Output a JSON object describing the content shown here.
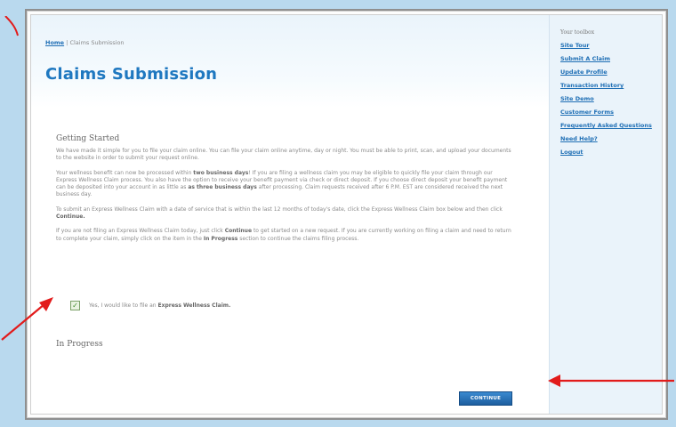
{
  "breadcrumb": {
    "home": "Home",
    "separator": "|",
    "current": "Claims Submission"
  },
  "page_title": "Claims Submission",
  "getting_started": {
    "heading": "Getting Started",
    "p1": "We have made it simple for you to file your claim online. You can file your claim online anytime, day or night. You must be able to print, scan, and upload your documents to the website in order to submit your request online.",
    "p2_a": "Your wellness benefit can now be processed within ",
    "p2_b": "two business days",
    "p2_c": "! If you are filing a wellness claim you may be eligible to quickly file your claim through our Express Wellness Claim process. You also have the option to receive your benefit payment via check or direct deposit. If you choose direct deposit your benefit payment can be deposited into your account in as little as ",
    "p2_d": "as three business days",
    "p2_e": " after processing. Claim requests received after 6 P.M. EST are considered received the next business day.",
    "p3_a": "To submit an Express Wellness Claim with a date of service that is within the last 12 months of today's date, click the Express Wellness Claim box below and then click ",
    "p3_b": "Continue.",
    "p4_a": "If you are not filing an Express Wellness Claim today, just click ",
    "p4_b": "Continue",
    "p4_c": " to get started on a new request. If you are currently working on filing a claim and need to return to complete your claim, simply click on the item in the ",
    "p4_d": "In Progress",
    "p4_e": " section to continue the claims filing process."
  },
  "express_checkbox": {
    "checked": true,
    "mark": "✓",
    "label_a": "Yes, I would like to file an ",
    "label_b": "Express Wellness Claim."
  },
  "in_progress": {
    "heading": "In Progress"
  },
  "continue_button": {
    "label": "CONTINUE"
  },
  "sidebar": {
    "title": "Your toolbox",
    "items": [
      "Site Tour",
      "Submit A Claim",
      "Update Profile",
      "Transaction History",
      "Site Demo",
      "Customer Forms",
      "Frequently Asked Questions",
      "Need Help?",
      "Logout"
    ]
  },
  "colors": {
    "brand_blue": "#1f78c0",
    "arrow_red": "#e21b1b",
    "button_blue": "#1d5e9f"
  }
}
